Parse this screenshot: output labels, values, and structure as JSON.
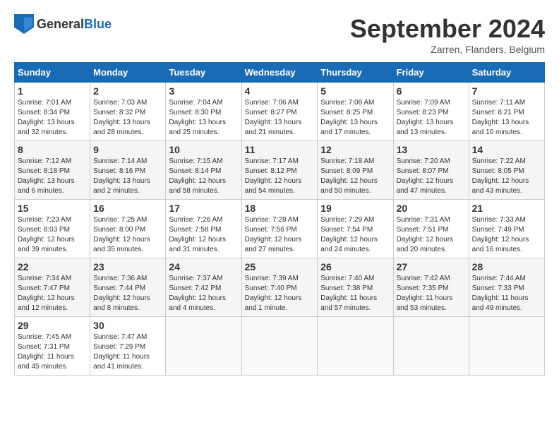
{
  "header": {
    "logo_general": "General",
    "logo_blue": "Blue",
    "month_title": "September 2024",
    "subtitle": "Zarren, Flanders, Belgium"
  },
  "days_of_week": [
    "Sunday",
    "Monday",
    "Tuesday",
    "Wednesday",
    "Thursday",
    "Friday",
    "Saturday"
  ],
  "weeks": [
    [
      {
        "day": "1",
        "info": "Sunrise: 7:01 AM\nSunset: 8:34 PM\nDaylight: 13 hours\nand 32 minutes."
      },
      {
        "day": "2",
        "info": "Sunrise: 7:03 AM\nSunset: 8:32 PM\nDaylight: 13 hours\nand 28 minutes."
      },
      {
        "day": "3",
        "info": "Sunrise: 7:04 AM\nSunset: 8:30 PM\nDaylight: 13 hours\nand 25 minutes."
      },
      {
        "day": "4",
        "info": "Sunrise: 7:06 AM\nSunset: 8:27 PM\nDaylight: 13 hours\nand 21 minutes."
      },
      {
        "day": "5",
        "info": "Sunrise: 7:08 AM\nSunset: 8:25 PM\nDaylight: 13 hours\nand 17 minutes."
      },
      {
        "day": "6",
        "info": "Sunrise: 7:09 AM\nSunset: 8:23 PM\nDaylight: 13 hours\nand 13 minutes."
      },
      {
        "day": "7",
        "info": "Sunrise: 7:11 AM\nSunset: 8:21 PM\nDaylight: 13 hours\nand 10 minutes."
      }
    ],
    [
      {
        "day": "8",
        "info": "Sunrise: 7:12 AM\nSunset: 8:18 PM\nDaylight: 13 hours\nand 6 minutes."
      },
      {
        "day": "9",
        "info": "Sunrise: 7:14 AM\nSunset: 8:16 PM\nDaylight: 13 hours\nand 2 minutes."
      },
      {
        "day": "10",
        "info": "Sunrise: 7:15 AM\nSunset: 8:14 PM\nDaylight: 12 hours\nand 58 minutes."
      },
      {
        "day": "11",
        "info": "Sunrise: 7:17 AM\nSunset: 8:12 PM\nDaylight: 12 hours\nand 54 minutes."
      },
      {
        "day": "12",
        "info": "Sunrise: 7:18 AM\nSunset: 8:09 PM\nDaylight: 12 hours\nand 50 minutes."
      },
      {
        "day": "13",
        "info": "Sunrise: 7:20 AM\nSunset: 8:07 PM\nDaylight: 12 hours\nand 47 minutes."
      },
      {
        "day": "14",
        "info": "Sunrise: 7:22 AM\nSunset: 8:05 PM\nDaylight: 12 hours\nand 43 minutes."
      }
    ],
    [
      {
        "day": "15",
        "info": "Sunrise: 7:23 AM\nSunset: 8:03 PM\nDaylight: 12 hours\nand 39 minutes."
      },
      {
        "day": "16",
        "info": "Sunrise: 7:25 AM\nSunset: 8:00 PM\nDaylight: 12 hours\nand 35 minutes."
      },
      {
        "day": "17",
        "info": "Sunrise: 7:26 AM\nSunset: 7:58 PM\nDaylight: 12 hours\nand 31 minutes."
      },
      {
        "day": "18",
        "info": "Sunrise: 7:28 AM\nSunset: 7:56 PM\nDaylight: 12 hours\nand 27 minutes."
      },
      {
        "day": "19",
        "info": "Sunrise: 7:29 AM\nSunset: 7:54 PM\nDaylight: 12 hours\nand 24 minutes."
      },
      {
        "day": "20",
        "info": "Sunrise: 7:31 AM\nSunset: 7:51 PM\nDaylight: 12 hours\nand 20 minutes."
      },
      {
        "day": "21",
        "info": "Sunrise: 7:33 AM\nSunset: 7:49 PM\nDaylight: 12 hours\nand 16 minutes."
      }
    ],
    [
      {
        "day": "22",
        "info": "Sunrise: 7:34 AM\nSunset: 7:47 PM\nDaylight: 12 hours\nand 12 minutes."
      },
      {
        "day": "23",
        "info": "Sunrise: 7:36 AM\nSunset: 7:44 PM\nDaylight: 12 hours\nand 8 minutes."
      },
      {
        "day": "24",
        "info": "Sunrise: 7:37 AM\nSunset: 7:42 PM\nDaylight: 12 hours\nand 4 minutes."
      },
      {
        "day": "25",
        "info": "Sunrise: 7:39 AM\nSunset: 7:40 PM\nDaylight: 12 hours\nand 1 minute."
      },
      {
        "day": "26",
        "info": "Sunrise: 7:40 AM\nSunset: 7:38 PM\nDaylight: 11 hours\nand 57 minutes."
      },
      {
        "day": "27",
        "info": "Sunrise: 7:42 AM\nSunset: 7:35 PM\nDaylight: 11 hours\nand 53 minutes."
      },
      {
        "day": "28",
        "info": "Sunrise: 7:44 AM\nSunset: 7:33 PM\nDaylight: 11 hours\nand 49 minutes."
      }
    ],
    [
      {
        "day": "29",
        "info": "Sunrise: 7:45 AM\nSunset: 7:31 PM\nDaylight: 11 hours\nand 45 minutes."
      },
      {
        "day": "30",
        "info": "Sunrise: 7:47 AM\nSunset: 7:29 PM\nDaylight: 11 hours\nand 41 minutes."
      },
      {
        "day": "",
        "info": ""
      },
      {
        "day": "",
        "info": ""
      },
      {
        "day": "",
        "info": ""
      },
      {
        "day": "",
        "info": ""
      },
      {
        "day": "",
        "info": ""
      }
    ]
  ]
}
